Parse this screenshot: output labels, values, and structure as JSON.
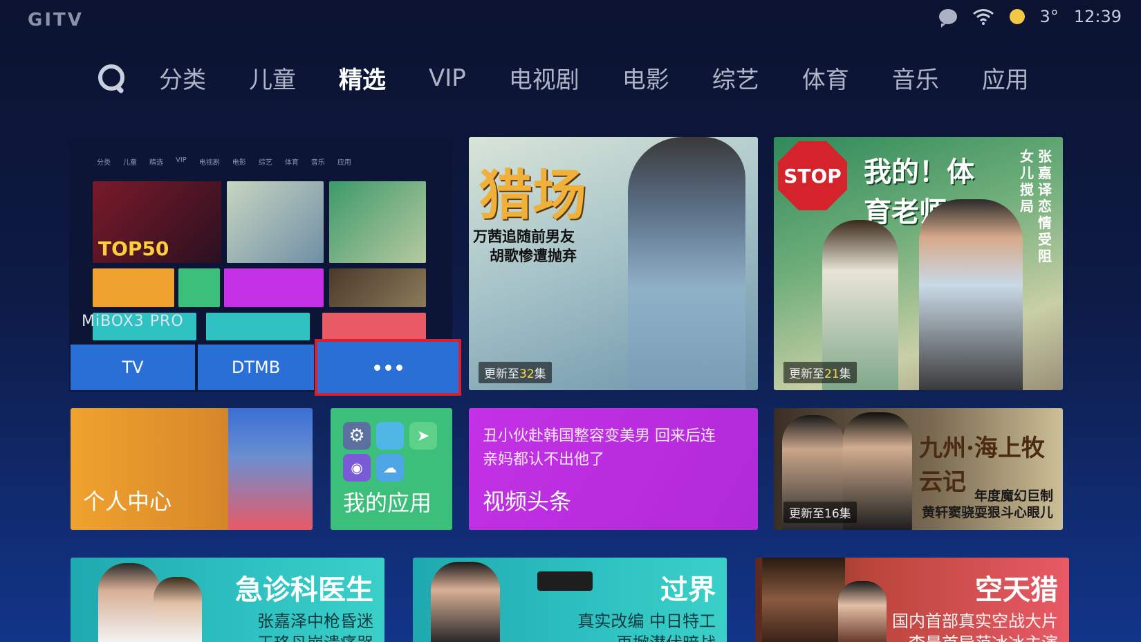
{
  "status": {
    "logo": "GITV",
    "temperature": "3°",
    "time": "12:39"
  },
  "nav": {
    "items": [
      "分类",
      "儿童",
      "精选",
      "VIP",
      "电视剧",
      "电影",
      "综艺",
      "体育",
      "音乐",
      "应用"
    ],
    "active_index": 2
  },
  "device_tile": {
    "label": "MiBOX3  PRO",
    "buttons": [
      "TV",
      "DTMB"
    ],
    "mini_nav": [
      "分类",
      "儿童",
      "精选",
      "VIP",
      "电视剧",
      "电影",
      "综艺",
      "体育",
      "音乐",
      "应用"
    ],
    "mini_text_top50": "TOP50"
  },
  "show1": {
    "title": "猎场",
    "tagline1": "万茜追随前男友",
    "tagline2": "胡歌惨遭抛弃",
    "episode_prefix": "更新至",
    "episode_num": "32",
    "episode_suffix": "集"
  },
  "show2": {
    "title": "我的！体育老师",
    "stop": "STOP",
    "side": "张嘉译恋情受阻",
    "side2": "女儿搅局",
    "episode_prefix": "更新至",
    "episode_num": "21",
    "episode_suffix": "集"
  },
  "personal": {
    "label": "个人中心"
  },
  "apps": {
    "label": "我的应用"
  },
  "news": {
    "line1": "丑小伙赴韩国整容变美男 回来后连",
    "line2": "亲妈都认不出他了",
    "label": "视频头条"
  },
  "show3": {
    "title": "九州·海上牧云记",
    "sub1": "年度魔幻巨制",
    "sub2": "黄轩窦骁耍狠斗心眼儿",
    "episode": "更新至16集"
  },
  "bottom": [
    {
      "title": "急诊科医生",
      "line1": "张嘉泽中枪昏迷",
      "line2": "王珞丹崩溃痛哭"
    },
    {
      "title": "过界",
      "line1": "真实改编  中日特工",
      "line2": "再掀潜伏暗战"
    },
    {
      "title": "空天猎",
      "line1": "国内首部真实空战大片",
      "line2": "李晨首导范冰冰主演"
    }
  ],
  "colors": {
    "accent_blue": "#2a6fd6",
    "focus_red": "#e21d2a",
    "orange": "#f0a22e",
    "green": "#3bbf7a",
    "purple": "#c431e6",
    "teal": "#2fc2c2",
    "coral": "#e85a66"
  }
}
